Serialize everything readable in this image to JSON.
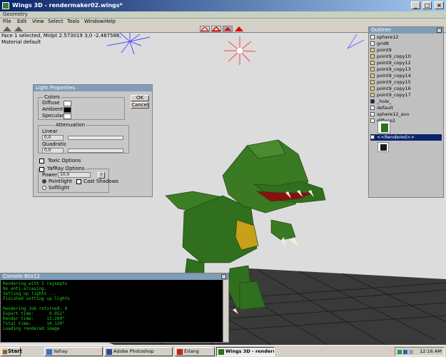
{
  "window": {
    "title": "Wings 3D - rendermaker02.wings*",
    "controls": [
      "_",
      "□",
      "×"
    ]
  },
  "geometry_bar": {
    "label": "Geometry"
  },
  "menu": [
    "File",
    "Edit",
    "View",
    "Select",
    "Tools",
    "Window",
    "Help"
  ],
  "status": {
    "line1": "Face 1 selected, Midpt 2.573019 3,0 -2,467586,",
    "line2": "Material default"
  },
  "light_dialog": {
    "title": "Light Properties",
    "ok": "OK",
    "cancel": "Cancel",
    "colors": {
      "group": "Colors",
      "diffuse": "Diffuse",
      "ambient": "Ambient",
      "specular": "Specular",
      "diffuse_color": "#ffffff",
      "ambient_color": "#000000",
      "specular_color": "#ffffff"
    },
    "attenuation": {
      "group": "Attenuation",
      "linear_label": "Linear",
      "linear_value": "0,0",
      "quadratic_label": "Quadratic",
      "quadratic_value": "0,0"
    },
    "toxic_options": "Toxic Options",
    "yafray": {
      "group": "YafRay Options",
      "power_label": "Power",
      "power_value": "10,0",
      "help": "?",
      "pointlight": "Pointlight",
      "cast_shadows": "Cast Shadows",
      "softlight": "Softlight"
    }
  },
  "outliner": {
    "title": "Outliner",
    "items": [
      "sphere12",
      "grid8",
      "point9",
      "point9_copy10",
      "point9_copy12",
      "point9_copy13",
      "point9_copy14",
      "point9_copy15",
      "point9_copy16",
      "point9_copy17",
      "_hole_",
      "default",
      "sphere12_auv",
      "diffuse2"
    ],
    "selected_item": "<<Rendered>>"
  },
  "console": {
    "title": "Console 80x12",
    "lines": [
      "Rendering with 3 raysmptn",
      "No anti-aliasing.",
      "Setting up lights ...",
      "Finished setting up lights",
      "",
      "Rendering Job returned: 0",
      "Export time:      0.051\"",
      "Render time:     13.269\"",
      "Total time:      14.120\"",
      "Loading rendered image"
    ]
  },
  "taskbar": {
    "start": "Start",
    "tasks": [
      "Yafray",
      "Adobe Photoshop",
      "Erlang",
      "Wings 3D - rendermak..."
    ],
    "clock": "12:16 AM"
  },
  "colors": {
    "accent": "#0a246a",
    "dino_green": "#2f6f1e",
    "console_text": "#1fd21f",
    "viewport_bg": "#dcdcdc"
  }
}
